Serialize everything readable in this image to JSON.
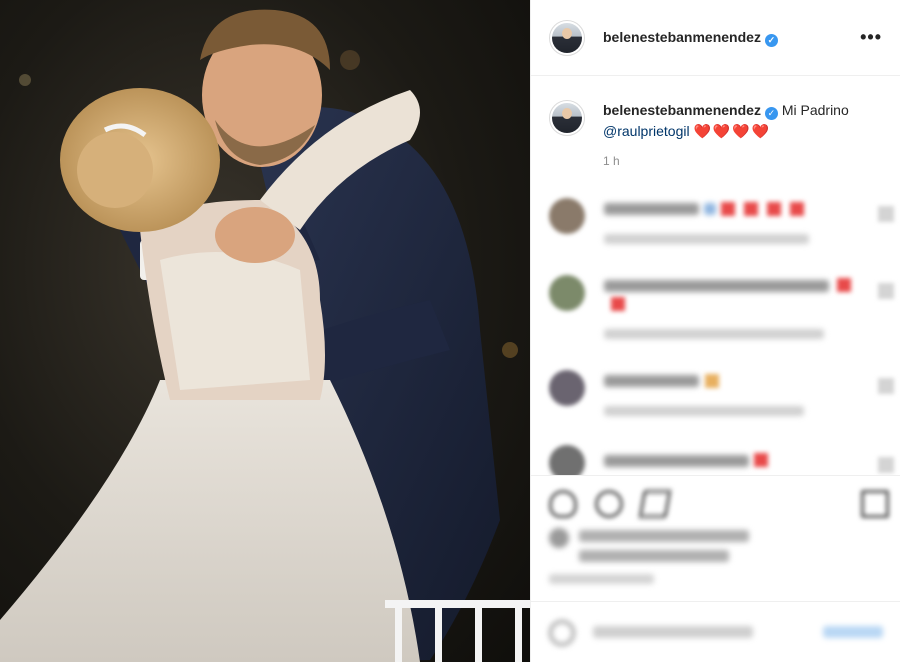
{
  "post": {
    "username": "belenestebanmenendez",
    "verified_icon": "verified-badge-icon",
    "more_icon": "more-options-icon",
    "more_label": "•••",
    "caption_text": "Mi Padrino",
    "caption_mention": "@raulprietogil",
    "caption_emoji": "❤️❤️❤️❤️",
    "time_ago": "1 h"
  },
  "colors": {
    "verified": "#3897f0",
    "mention": "#003569",
    "heart": "#ed1c24",
    "muted": "#8e8e8e",
    "border": "#efefef"
  },
  "icons": [
    "heart-icon",
    "comment-icon",
    "share-icon",
    "bookmark-icon",
    "emoji-icon"
  ]
}
